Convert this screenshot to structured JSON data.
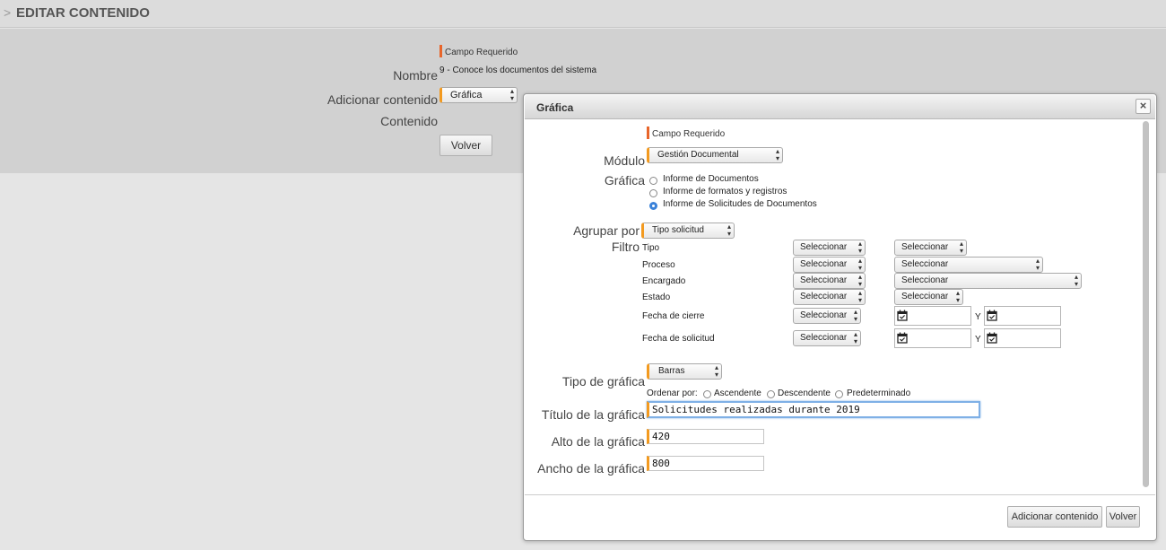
{
  "header": {
    "chevron": ">",
    "title": "EDITAR CONTENIDO"
  },
  "form": {
    "required_note": "Campo Requerido",
    "nombre_label": "Nombre",
    "nombre_value": "9 - Conoce los documentos del sistema",
    "adicionar_label": "Adicionar contenido",
    "adicionar_select": "Gráfica",
    "contenido_label": "Contenido",
    "volver_button": "Volver"
  },
  "dialog": {
    "title": "Gráfica",
    "close": "×",
    "required_note": "Campo Requerido",
    "modulo_label": "Módulo",
    "modulo_value": "Gestión Documental",
    "grafica_label": "Gráfica",
    "grafica_options": [
      {
        "label": "Informe de Documentos",
        "selected": false
      },
      {
        "label": "Informe de formatos y registros",
        "selected": false
      },
      {
        "label": "Informe de Solicitudes de Documentos",
        "selected": true
      }
    ],
    "agrupar_label": "Agrupar por",
    "agrupar_value": "Tipo solicitud",
    "filtro_label": "Filtro",
    "filters": [
      {
        "label": "Tipo",
        "op": "Seleccionar",
        "value": "Seleccionar"
      },
      {
        "label": "Proceso",
        "op": "Seleccionar",
        "value": "Seleccionar"
      },
      {
        "label": "Encargado",
        "op": "Seleccionar",
        "value": "Seleccionar"
      },
      {
        "label": "Estado",
        "op": "Seleccionar",
        "value": "Seleccionar"
      },
      {
        "label": "Fecha de cierre",
        "op": "Seleccionar",
        "y": "Y"
      },
      {
        "label": "Fecha de solicitud",
        "op": "Seleccionar",
        "y": "Y"
      }
    ],
    "tipo_label": "Tipo de gráfica",
    "tipo_value": "Barras",
    "ordenar_label": "Ordenar por:",
    "order_options": [
      "Ascendente",
      "Descendente",
      "Predeterminado"
    ],
    "titulo_label": "Título de la gráfica",
    "titulo_value": "Solicitudes realizadas durante 2019",
    "alto_label": "Alto de la gráfica",
    "alto_value": "420",
    "ancho_label": "Ancho de la gráfica",
    "ancho_value": "800",
    "adicionar_button": "Adicionar contenido",
    "volver_button": "Volver"
  },
  "colors": {
    "required": "#e8652a",
    "accent_border": "#f39a1f",
    "radio_on": "#3b82d9"
  }
}
